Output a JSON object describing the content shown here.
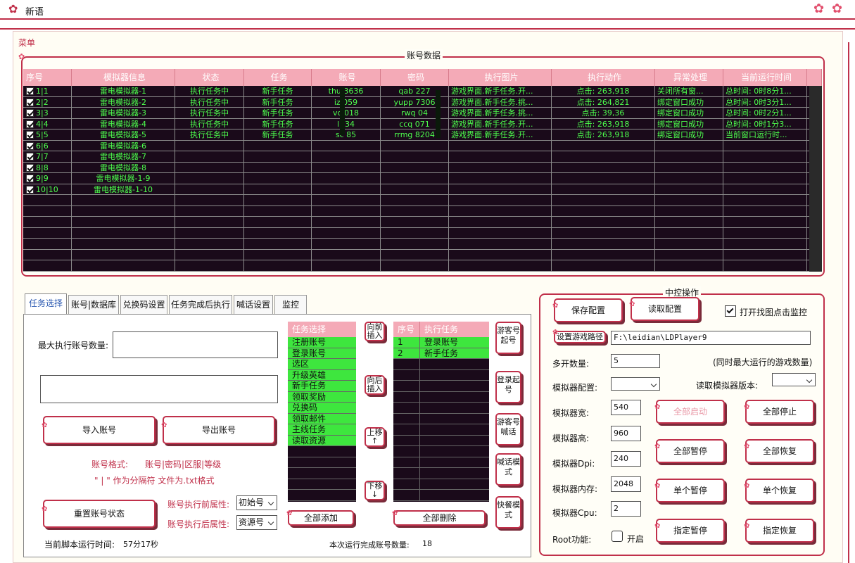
{
  "window": {
    "title": "新语"
  },
  "menu": {
    "label": "菜单"
  },
  "account_panel": {
    "title": "账号数据",
    "columns": [
      "序号",
      "模拟器信息",
      "状态",
      "任务",
      "账号",
      "密码",
      "执行图片",
      "执行动作",
      "异常处理",
      "当前运行时间"
    ],
    "rows": [
      {
        "idx": "1|1",
        "emu": "雷电模拟器-1",
        "status": "执行任务中",
        "task": "新手任务",
        "acct": "thu   3636",
        "pwd": "qab 227",
        "img": "游戏界面.新手任务.开...",
        "action": "点击: 263,918",
        "err": "关闭所有窗...",
        "time": "总时间: 0时8分1..."
      },
      {
        "idx": "2|2",
        "emu": "雷电模拟器-2",
        "status": "执行任务中",
        "task": "新手任务",
        "acct": "iz   059",
        "pwd": "yupp   7306",
        "img": "游戏界面.新手任务.挑...",
        "action": "点击: 264,821",
        "err": "绑定窗口成功",
        "time": "总时间: 0时3分1..."
      },
      {
        "idx": "3|3",
        "emu": "雷电模拟器-3",
        "status": "执行任务中",
        "task": "新手任务",
        "acct": "vc   018",
        "pwd": "rwq   04",
        "img": "游戏界面.新手任务.挑...",
        "action": "点击: 39,36",
        "err": "绑定窗口成功",
        "time": "总时间: 0时2分1..."
      },
      {
        "idx": "4|4",
        "emu": "雷电模拟器-4",
        "status": "执行任务中",
        "task": "新手任务",
        "acct": "lr   34",
        "pwd": "ccq   071",
        "img": "游戏界面.新手任务.开...",
        "action": "点击: 263,918",
        "err": "绑定窗口成功",
        "time": "总时间: 0时1分3..."
      },
      {
        "idx": "5|5",
        "emu": "雷电模拟器-5",
        "status": "执行任务中",
        "task": "新手任务",
        "acct": "sc   85",
        "pwd": "rrmg   8204",
        "img": "游戏界面.新手任务.开...",
        "action": "点击: 263,918",
        "err": "绑定窗口成功",
        "time": "当前窗口运行时..."
      },
      {
        "idx": "6|6",
        "emu": "雷电模拟器-6"
      },
      {
        "idx": "7|7",
        "emu": "雷电模拟器-7"
      },
      {
        "idx": "8|8",
        "emu": "雷电模拟器-8"
      },
      {
        "idx": "9|9",
        "emu": "雷电模拟器-1-9"
      },
      {
        "idx": "10|10",
        "emu": "雷电模拟器-1-10"
      }
    ]
  },
  "tabs": [
    "任务选择",
    "账号|数据库",
    "兑换码设置",
    "任务完成后执行",
    "喊话设置",
    "监控"
  ],
  "task_tab": {
    "max_accounts_label": "最大执行账号数量:",
    "max_accounts_value": "",
    "import_btn": "导入账号",
    "export_btn": "导出账号",
    "format_label": "账号格式:",
    "format_value": "账号|密码|区服|等级",
    "separator_note": "\" | \" 作为分隔符 文件为.txt格式",
    "reset_btn": "重置账号状态",
    "before_attr_label": "账号执行前属性:",
    "before_attr_value": "初始号",
    "after_attr_label": "账号执行后属性:",
    "after_attr_value": "资源号",
    "runtime_label": "当前脚本运行时间:",
    "runtime_value": "57分17秒",
    "done_label": "本次运行完成账号数量:",
    "done_value": "18",
    "task_list_header": "任务选择",
    "task_list": [
      "注册账号",
      "登录账号",
      "选区",
      "升级英雄",
      "新手任务",
      "领取奖励",
      "兑换码",
      "领取邮件",
      "主线任务",
      "读取资源"
    ],
    "insert_before_btn": "向前插入",
    "insert_after_btn": "向后插入",
    "move_up_btn": "上移 ↑",
    "move_down_btn": "下移 ↓",
    "add_all_btn": "全部添加",
    "exec_header_idx": "序号",
    "exec_header_task": "执行任务",
    "exec_list": [
      {
        "idx": "1",
        "task": "登录账号"
      },
      {
        "idx": "2",
        "task": "新手任务"
      }
    ],
    "delete_all_btn": "全部删除",
    "guest_start_btn": "游客号起号",
    "login_start_btn": "登录起号",
    "guest_shout_btn": "游客号喊话",
    "shout_mode_btn": "喊话模式",
    "quick_mode_btn": "快餐模式"
  },
  "control_panel": {
    "title": "中控操作",
    "save_btn": "保存配置",
    "read_btn": "读取配置",
    "monitor_label": "打开找图点击监控",
    "monitor_checked": true,
    "game_path_btn": "设置游戏路径",
    "game_path_value": "F:\\leidian\\LDPlayer9",
    "multi_label": "多开数量:",
    "multi_value": "5",
    "multi_note": "(同时最大运行的游戏数量)",
    "emu_config_label": "模拟器配置:",
    "emu_version_label": "读取模拟器版本:",
    "width_label": "模拟器宽:",
    "width_value": "540",
    "height_label": "模拟器高:",
    "height_value": "960",
    "dpi_label": "模拟器Dpi:",
    "dpi_value": "240",
    "mem_label": "模拟器内存:",
    "mem_value": "2048",
    "cpu_label": "模拟器Cpu:",
    "cpu_value": "2",
    "root_label": "Root功能:",
    "root_on_label": "开启",
    "start_all_btn": "全部启动",
    "stop_all_btn": "全部停止",
    "pause_all_btn": "全部暂停",
    "resume_all_btn": "全部恢复",
    "pause_one_btn": "单个暂停",
    "resume_one_btn": "单个恢复",
    "pause_sel_btn": "指定暂停",
    "resume_sel_btn": "指定恢复"
  },
  "colors": {
    "accent": "#c0304a",
    "grid_bg": "#1a0a1a",
    "grid_text": "#4dff4d",
    "header_pink": "#f4aab7",
    "list_green": "#3ee63e"
  }
}
